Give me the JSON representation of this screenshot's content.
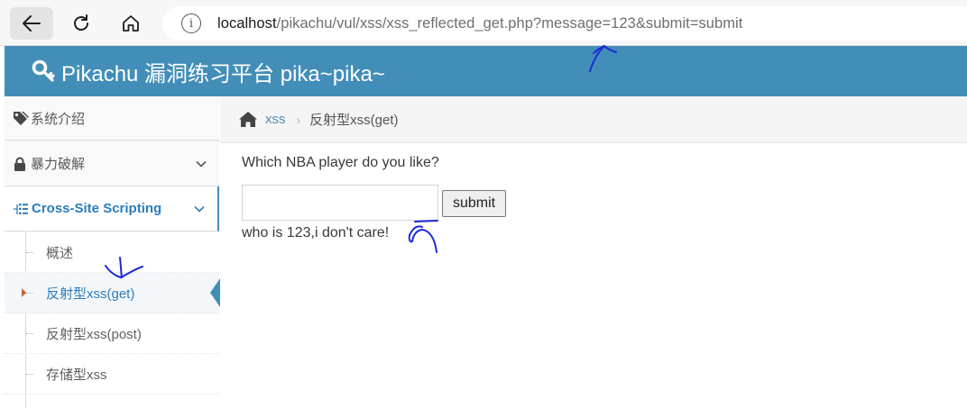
{
  "browser": {
    "url_host": "localhost",
    "url_path": "/pikachu/vul/xss/xss_reflected_get.php?message=123&submit=submit",
    "back_icon": "back-arrow-icon",
    "reload_icon": "reload-icon",
    "home_icon": "home-icon",
    "info_icon": "info-icon",
    "info_glyph": "i"
  },
  "header": {
    "title": "Pikachu 漏洞练习平台 pika~pika~",
    "icon": "key-icon",
    "color": "#438eb9"
  },
  "sidebar": {
    "items": [
      {
        "label": "系统介绍",
        "icon": "tags-icon"
      },
      {
        "label": "暴力破解",
        "icon": "lock-icon"
      },
      {
        "label": "Cross-Site Scripting",
        "icon": "list-tree-icon"
      }
    ],
    "sub_items": [
      {
        "label": "概述"
      },
      {
        "label": "反射型xss(get)",
        "active": true
      },
      {
        "label": "反射型xss(post)"
      },
      {
        "label": "存储型xss"
      }
    ]
  },
  "breadcrumb": {
    "link": "xss",
    "separator": "›",
    "current": "反射型xss(get)"
  },
  "main": {
    "question": "Which NBA player do you like?",
    "input_value": "",
    "submit_label": "submit",
    "result_text": "who is 123,i don't care!"
  },
  "colors": {
    "accent": "#438eb9",
    "link": "#2b7dbc",
    "annotation": "#1b2ad6"
  }
}
